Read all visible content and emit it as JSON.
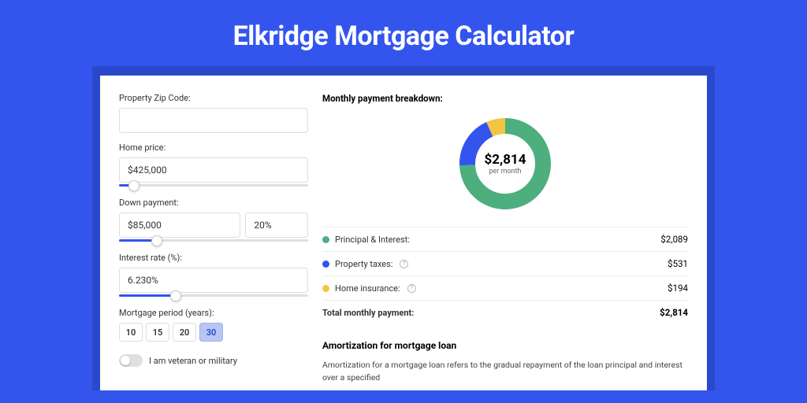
{
  "title": "Elkridge Mortgage Calculator",
  "form": {
    "zip_label": "Property Zip Code:",
    "zip_value": "",
    "home_price_label": "Home price:",
    "home_price_value": "$425,000",
    "home_price_slider_pct": 8,
    "down_payment_label": "Down payment:",
    "down_payment_value": "$85,000",
    "down_payment_pct_value": "20%",
    "down_payment_slider_pct": 20,
    "interest_label": "Interest rate (%):",
    "interest_value": "6.230%",
    "interest_slider_pct": 30,
    "period_label": "Mortgage period (years):",
    "period_options": [
      "10",
      "15",
      "20",
      "30"
    ],
    "period_selected": "30",
    "veteran_label": "I am veteran or military"
  },
  "breakdown": {
    "heading": "Monthly payment breakdown:",
    "total_amount": "$2,814",
    "total_sub": "per month",
    "items": [
      {
        "label": "Principal & Interest:",
        "value": "$2,089",
        "color": "green"
      },
      {
        "label": "Property taxes:",
        "value": "$531",
        "color": "blue",
        "info": true
      },
      {
        "label": "Home insurance:",
        "value": "$194",
        "color": "yellow",
        "info": true
      }
    ],
    "total_label": "Total monthly payment:",
    "total_value": "$2,814"
  },
  "amortization": {
    "heading": "Amortization for mortgage loan",
    "text": "Amortization for a mortgage loan refers to the gradual repayment of the loan principal and interest over a specified"
  },
  "chart_data": {
    "type": "pie",
    "title": "Monthly payment breakdown",
    "series": [
      {
        "name": "Principal & Interest",
        "value": 2089,
        "color": "#4caf7d"
      },
      {
        "name": "Property taxes",
        "value": 531,
        "color": "#3355ee"
      },
      {
        "name": "Home insurance",
        "value": 194,
        "color": "#f4c542"
      }
    ],
    "total": 2814
  }
}
